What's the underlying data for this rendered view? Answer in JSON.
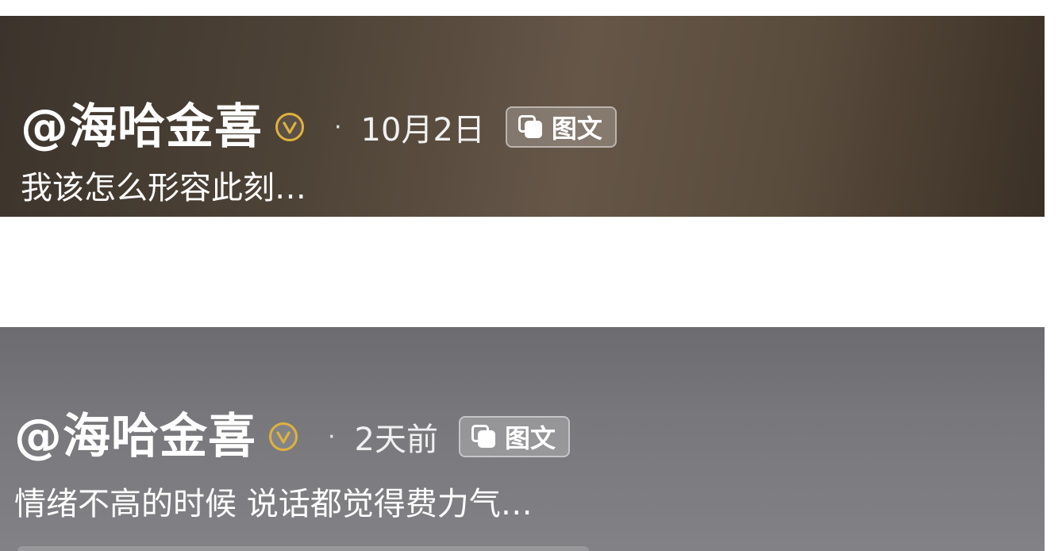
{
  "posts": [
    {
      "author": "@海哈金喜",
      "verified_icon": "verified-v-badge",
      "separator": "·",
      "time": "10月2日",
      "type_tag": {
        "icon": "gallery-icon",
        "label": "图文"
      },
      "caption": "我该怎么形容此刻…"
    },
    {
      "author": "@海哈金喜",
      "verified_icon": "verified-v-badge",
      "separator": "·",
      "time": "2天前",
      "type_tag": {
        "icon": "gallery-icon",
        "label": "图文"
      },
      "caption": "情绪不高的时候 说话都觉得费力气…"
    }
  ],
  "colors": {
    "verified_badge": "#e0b23c",
    "text": "#ffffff",
    "card1_bg": "#5a4c3d",
    "card2_bg": "#78787c"
  }
}
